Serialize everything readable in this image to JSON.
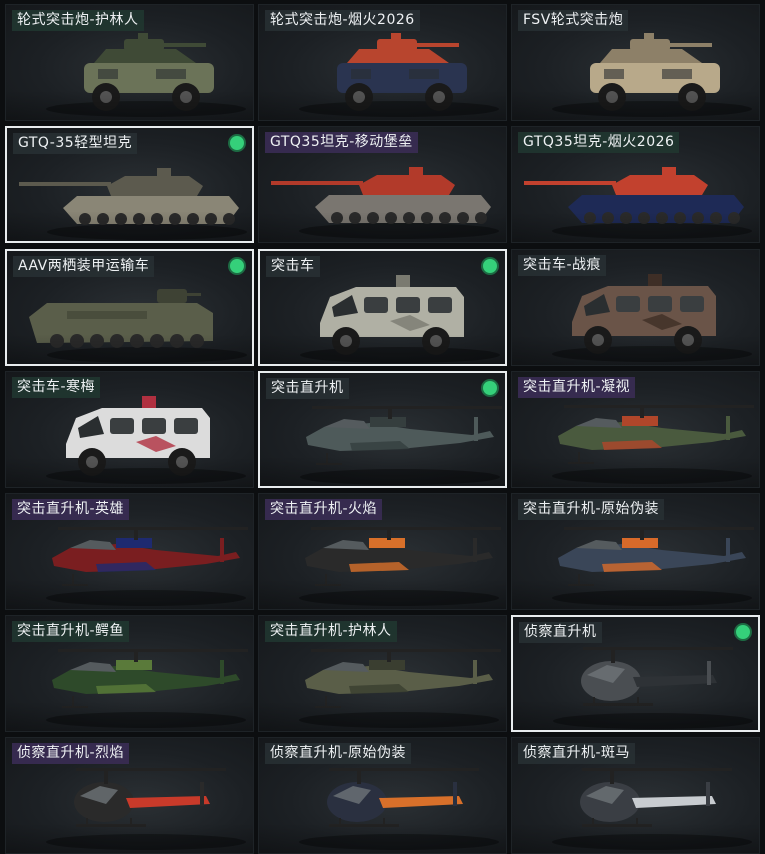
{
  "items": [
    {
      "label": "轮式突击炮-护林人",
      "kind": "wheeled-gun",
      "body": "#6b7358",
      "accent": "#3f4a36",
      "tag": "green",
      "selected": false
    },
    {
      "label": "轮式突击炮-烟火2026",
      "kind": "wheeled-gun",
      "body": "#2a3450",
      "accent": "#b8452e",
      "tag": "plain",
      "selected": false
    },
    {
      "label": "FSV轮式突击炮",
      "kind": "wheeled-gun",
      "body": "#b8a98a",
      "accent": "#8d8068",
      "tag": "plain",
      "selected": false
    },
    {
      "label": "GTQ-35轻型坦克",
      "kind": "tank",
      "body": "#8a8676",
      "accent": "#5c5a4e",
      "tag": "plain",
      "selected": true
    },
    {
      "label": "GTQ35坦克-移动堡垒",
      "kind": "tank",
      "body": "#7a7670",
      "accent": "#b23a2a",
      "tag": "rare",
      "selected": false
    },
    {
      "label": "GTQ35坦克-烟火2026",
      "kind": "tank",
      "body": "#1e2a56",
      "accent": "#c2412e",
      "tag": "green",
      "selected": false
    },
    {
      "label": "AAV两栖装甲运输车",
      "kind": "aav",
      "body": "#5a5e4a",
      "accent": "#3e4234",
      "tag": "plain",
      "selected": true
    },
    {
      "label": "突击车",
      "kind": "mrap",
      "body": "#b0b0a4",
      "accent": "#7a7a70",
      "tag": "plain",
      "selected": true
    },
    {
      "label": "突击车-战痕",
      "kind": "mrap",
      "body": "#6a5448",
      "accent": "#3e2e26",
      "tag": "plain",
      "selected": false
    },
    {
      "label": "突击车-寒梅",
      "kind": "mrap",
      "body": "#dcdcdc",
      "accent": "#b03040",
      "tag": "green",
      "selected": false
    },
    {
      "label": "突击直升机",
      "kind": "attack-heli",
      "body": "#4e5a5a",
      "accent": "#353e3e",
      "tag": "plain",
      "selected": true
    },
    {
      "label": "突击直升机-凝视",
      "kind": "attack-heli",
      "body": "#4a5a3e",
      "accent": "#b0462a",
      "tag": "rare",
      "selected": false
    },
    {
      "label": "突击直升机-英雄",
      "kind": "attack-heli",
      "body": "#7a1e20",
      "accent": "#1e2a70",
      "tag": "rare",
      "selected": false
    },
    {
      "label": "突击直升机-火焰",
      "kind": "attack-heli",
      "body": "#2a2a2a",
      "accent": "#d8702a",
      "tag": "rare",
      "selected": false
    },
    {
      "label": "突击直升机-原始伪装",
      "kind": "attack-heli",
      "body": "#3a4658",
      "accent": "#d86a2a",
      "tag": "plain",
      "selected": false
    },
    {
      "label": "突击直升机-鳄鱼",
      "kind": "attack-heli",
      "body": "#2e4a2a",
      "accent": "#5a7a3a",
      "tag": "green",
      "selected": false
    },
    {
      "label": "突击直升机-护林人",
      "kind": "attack-heli",
      "body": "#5a5e48",
      "accent": "#3a3e30",
      "tag": "green",
      "selected": false
    },
    {
      "label": "侦察直升机",
      "kind": "scout-heli",
      "body": "#4a4e52",
      "accent": "#2e3236",
      "tag": "plain",
      "selected": true
    },
    {
      "label": "侦察直升机-烈焰",
      "kind": "scout-heli",
      "body": "#2a2a2a",
      "accent": "#c83a2a",
      "tag": "rare",
      "selected": false
    },
    {
      "label": "侦察直升机-原始伪装",
      "kind": "scout-heli",
      "body": "#2a3040",
      "accent": "#d8702a",
      "tag": "plain",
      "selected": false
    },
    {
      "label": "侦察直升机-斑马",
      "kind": "scout-heli",
      "body": "#3a3e44",
      "accent": "#c8ccd0",
      "tag": "plain",
      "selected": false
    }
  ],
  "colors": {
    "selected_border": "#e8ecee",
    "equipped_dot": "#35d07a"
  }
}
